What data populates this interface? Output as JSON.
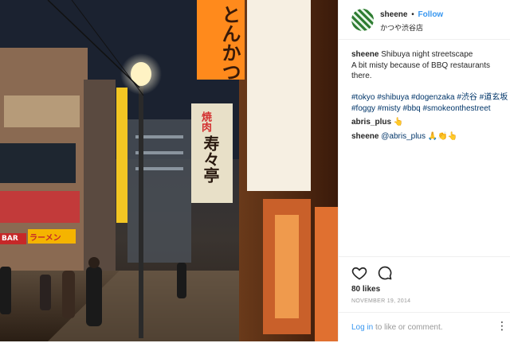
{
  "header": {
    "username": "sheene",
    "separator": "•",
    "follow_label": "Follow",
    "location": "かつや渋谷店"
  },
  "caption": {
    "username": "sheene",
    "line1": "Shibuya night streetscape",
    "line2": "A bit misty because of BBQ restaurants there.",
    "hashtags": "#tokyo #shibuya #dogenzaka #渋谷 #道玄坂 #foggy #misty #bbq #smokeonthestreet"
  },
  "comments": [
    {
      "username": "abris_plus",
      "text": "👆"
    },
    {
      "username": "sheene",
      "mention": "@abris_plus",
      "text": "🙏👏👆"
    }
  ],
  "actions": {
    "like_icon": "heart-icon",
    "comment_icon": "comment-bubble-icon",
    "likes": "80 likes",
    "date": "NOVEMBER 19, 2014"
  },
  "login": {
    "link": "Log in",
    "text": " to like or comment.",
    "more": "⋮"
  },
  "photo": {
    "sign_tonkatsu": "とんかつ",
    "sign_yakiniku": "焼肉",
    "sign_jujutei": "寿々亭",
    "sign_ramen": "ラーメン",
    "sign_bar": "BAR"
  },
  "colors": {
    "follow": "#3897f0",
    "hashtag": "#003569",
    "neon_orange": "#ff8a1c",
    "neon_red": "#e53935"
  }
}
